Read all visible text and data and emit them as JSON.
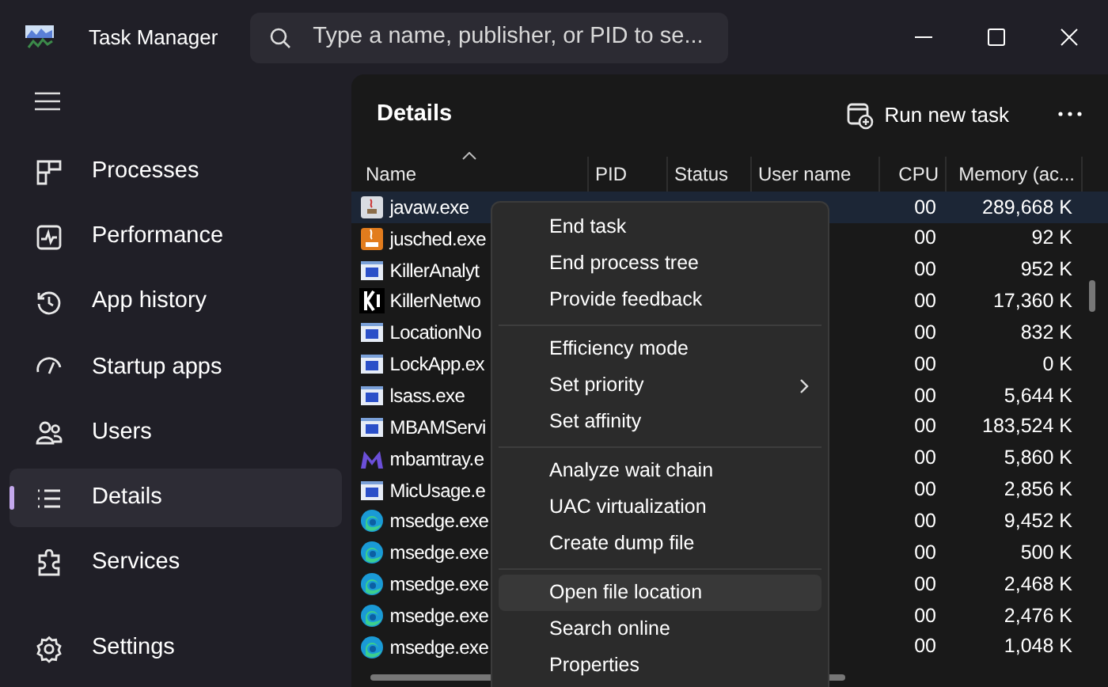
{
  "window": {
    "title": "Task Manager",
    "search_placeholder": "Type a name, publisher, or PID to se..."
  },
  "sidebar": {
    "items": [
      {
        "label": "Processes",
        "selected": false
      },
      {
        "label": "Performance",
        "selected": false
      },
      {
        "label": "App history",
        "selected": false
      },
      {
        "label": "Startup apps",
        "selected": false
      },
      {
        "label": "Users",
        "selected": false
      },
      {
        "label": "Details",
        "selected": true
      },
      {
        "label": "Services",
        "selected": false
      }
    ],
    "settings": {
      "label": "Settings"
    }
  },
  "page": {
    "title": "Details",
    "run_new_task": "Run new task"
  },
  "table": {
    "columns": [
      "Name",
      "PID",
      "Status",
      "User name",
      "CPU",
      "Memory (ac..."
    ],
    "rows": [
      {
        "name": "javaw.exe",
        "kind": "java",
        "cpu": "00",
        "memory": "289,668 K",
        "selected": true
      },
      {
        "name": "jusched.exe",
        "kind": "java-update",
        "cpu": "00",
        "memory": "92 K",
        "selected": false
      },
      {
        "name": "KillerAnalyt",
        "kind": "window",
        "cpu": "00",
        "memory": "952 K",
        "selected": false
      },
      {
        "name": "KillerNetwo",
        "kind": "killer",
        "cpu": "00",
        "memory": "17,360 K",
        "selected": false
      },
      {
        "name": "LocationNo",
        "kind": "window",
        "cpu": "00",
        "memory": "832 K",
        "selected": false
      },
      {
        "name": "LockApp.ex",
        "kind": "window",
        "cpu": "00",
        "memory": "0 K",
        "selected": false
      },
      {
        "name": "lsass.exe",
        "kind": "window",
        "cpu": "00",
        "memory": "5,644 K",
        "selected": false
      },
      {
        "name": "MBAMServi",
        "kind": "window",
        "cpu": "00",
        "memory": "183,524 K",
        "selected": false
      },
      {
        "name": "mbamtray.e",
        "kind": "m-logo",
        "cpu": "00",
        "memory": "5,860 K",
        "selected": false
      },
      {
        "name": "MicUsage.e",
        "kind": "window",
        "cpu": "00",
        "memory": "2,856 K",
        "selected": false
      },
      {
        "name": "msedge.exe",
        "kind": "edge",
        "cpu": "00",
        "memory": "9,452 K",
        "selected": false
      },
      {
        "name": "msedge.exe",
        "kind": "edge",
        "cpu": "00",
        "memory": "500 K",
        "selected": false
      },
      {
        "name": "msedge.exe",
        "kind": "edge",
        "cpu": "00",
        "memory": "2,468 K",
        "selected": false
      },
      {
        "name": "msedge.exe",
        "kind": "edge",
        "cpu": "00",
        "memory": "2,476 K",
        "selected": false
      },
      {
        "name": "msedge.exe",
        "kind": "edge",
        "cpu": "00",
        "memory": "1,048 K",
        "selected": false
      }
    ]
  },
  "context_menu": {
    "groups": [
      [
        {
          "label": "End task",
          "submenu": false,
          "selected": false
        },
        {
          "label": "End process tree",
          "submenu": false,
          "selected": false
        },
        {
          "label": "Provide feedback",
          "submenu": false,
          "selected": false
        }
      ],
      [
        {
          "label": "Efficiency mode",
          "submenu": false,
          "selected": false
        },
        {
          "label": "Set priority",
          "submenu": true,
          "selected": false
        },
        {
          "label": "Set affinity",
          "submenu": false,
          "selected": false
        }
      ],
      [
        {
          "label": "Analyze wait chain",
          "submenu": false,
          "selected": false
        },
        {
          "label": "UAC virtualization",
          "submenu": false,
          "selected": false
        },
        {
          "label": "Create dump file",
          "submenu": false,
          "selected": false
        }
      ],
      [
        {
          "label": "Open file location",
          "submenu": false,
          "selected": true
        },
        {
          "label": "Search online",
          "submenu": false,
          "selected": false
        },
        {
          "label": "Properties",
          "submenu": false,
          "selected": false
        }
      ]
    ]
  }
}
